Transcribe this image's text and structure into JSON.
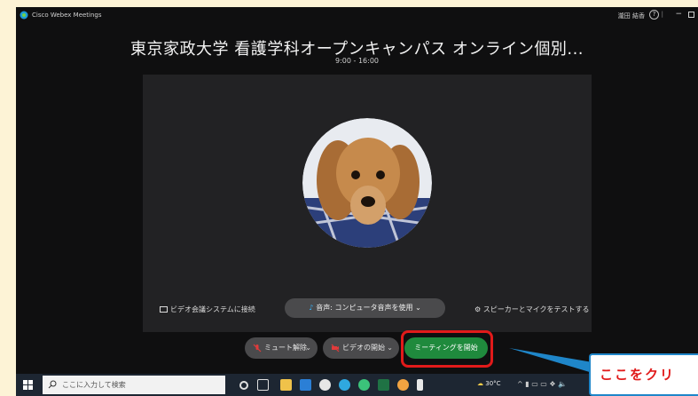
{
  "titlebar": {
    "app_name": "Cisco Webex Meetings",
    "user_name": "瀧田 結香",
    "help_glyph": "?",
    "separator": "|",
    "minimize_glyph": "−"
  },
  "meeting": {
    "title": "東京家政大学 看護学科オープンキャンパス オンライン個別...",
    "time": "9:00 - 16:00"
  },
  "options": {
    "video_system": "ビデオ会議システムに接続",
    "audio": "音声: コンピュータ音声を使用",
    "audio_chevron": "⌄",
    "speaker_test": "スピーカーとマイクをテストする",
    "speaker_glyph": "⚙"
  },
  "controls": {
    "mute_label": "ミュート解除",
    "video_label": "ビデオの開始",
    "start_label": "ミーティングを開始",
    "chevron": "⌄"
  },
  "taskbar": {
    "search_placeholder": "ここに入力して検索",
    "weather": "30°C",
    "tray_glyphs": "^  ▮  ▭  ▭  ❖  🔈"
  },
  "callout": {
    "text": "ここをクリ"
  },
  "colors": {
    "background": "#0f0f10",
    "start_button": "#1f8a3d",
    "highlight": "#e11a1a",
    "callout_text": "#e11a1a",
    "callout_border": "#1f86c9"
  },
  "icons": [
    "webex-logo-icon",
    "help-icon",
    "minimize-icon",
    "restore-icon",
    "cast-icon",
    "audio-icon",
    "gear-icon",
    "mic-muted-icon",
    "video-off-icon",
    "windows-icon",
    "search-icon"
  ]
}
